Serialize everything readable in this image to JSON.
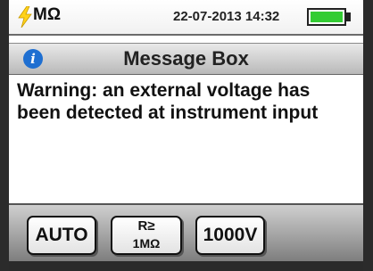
{
  "status_bar": {
    "measure_icon": "lightning-bolt-icon",
    "unit": "MΩ",
    "datetime": "22-07-2013 14:32",
    "battery_level": 1.0,
    "battery_color": "#33cc33"
  },
  "message_box": {
    "icon": "info-icon",
    "title": "Message Box",
    "message": "Warning: an external voltage has been detected at instrument input"
  },
  "function_keys": {
    "auto_label": "AUTO",
    "resistance_label_top": "R≥",
    "resistance_label_bottom": "1MΩ",
    "voltage_label": "1000V"
  },
  "colors": {
    "info_icon": "#1f6fd1",
    "bolt": "#ffd21a"
  }
}
